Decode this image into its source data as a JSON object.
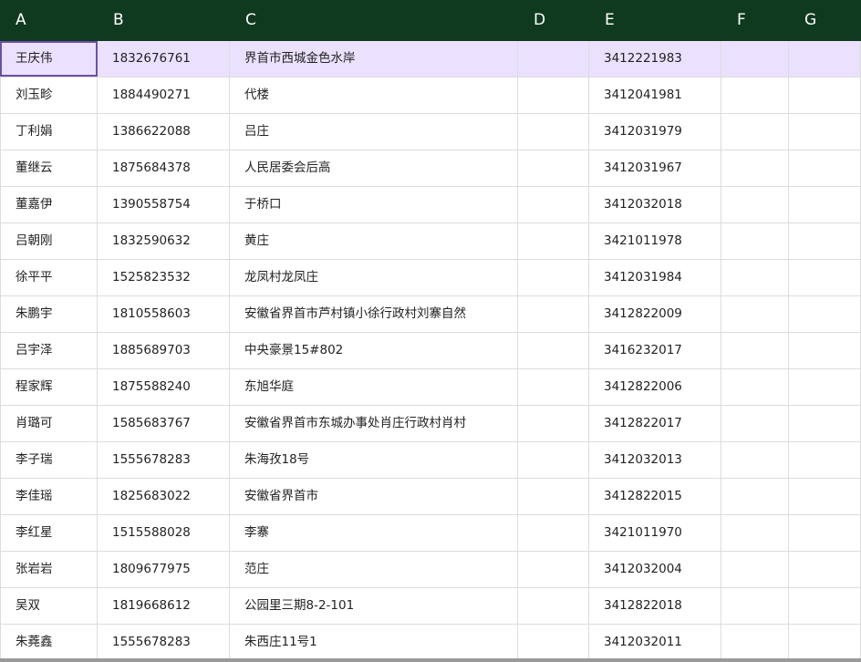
{
  "columns": [
    "A",
    "B",
    "C",
    "D",
    "E",
    "F",
    "G"
  ],
  "rows": [
    [
      "王庆伟",
      "1832676761",
      "界首市西城金色水岸",
      "",
      "3412221983",
      "",
      ""
    ],
    [
      "刘玉畛",
      "1884490271",
      "代楼",
      "",
      "3412041981",
      "",
      ""
    ],
    [
      "丁利娟",
      "1386622088",
      "吕庄",
      "",
      "3412031979",
      "",
      ""
    ],
    [
      "董继云",
      "1875684378",
      "人民居委会后高",
      "",
      "3412031967",
      "",
      ""
    ],
    [
      "董嘉伊",
      "1390558754",
      "于桥口",
      "",
      "3412032018",
      "",
      ""
    ],
    [
      "吕朝刚",
      "1832590632",
      "黄庄",
      "",
      "3421011978",
      "",
      ""
    ],
    [
      "徐平平",
      "1525823532",
      "龙凤村龙凤庄",
      "",
      "3412031984",
      "",
      ""
    ],
    [
      "朱鹏宇",
      "1810558603",
      "安徽省界首市芦村镇小徐行政村刘寨自然",
      "",
      "3412822009",
      "",
      ""
    ],
    [
      "吕宇泽",
      "1885689703",
      "中央豪景15#802",
      "",
      "3416232017",
      "",
      ""
    ],
    [
      "程家辉",
      "1875588240",
      "东旭华庭",
      "",
      "3412822006",
      "",
      ""
    ],
    [
      "肖璐可",
      "1585683767",
      "安徽省界首市东城办事处肖庄行政村肖村",
      "",
      "3412822017",
      "",
      ""
    ],
    [
      "李子瑞",
      "1555678283",
      "朱海孜18号",
      "",
      "3412032013",
      "",
      ""
    ],
    [
      "李佳瑶",
      "1825683022",
      "安徽省界首市",
      "",
      "3412822015",
      "",
      ""
    ],
    [
      "李红星",
      "1515588028",
      "李寨",
      "",
      "3421011970",
      "",
      ""
    ],
    [
      "张岩岩",
      "1809677975",
      "范庄",
      "",
      "3412032004",
      "",
      ""
    ],
    [
      "吴双",
      "1819668612",
      "公园里三期8-2-101",
      "",
      "3412822018",
      "",
      ""
    ],
    [
      "朱蕘鑫",
      "1555678283",
      "朱西庄11号1",
      "",
      "3412032011",
      "",
      ""
    ]
  ],
  "selected_row": 0,
  "colors": {
    "header_bg": "#0f3a1f",
    "header_text": "#ffffff",
    "selected_row_bg": "#ebe1ff",
    "active_cell_border": "#6a4fa8",
    "grid_line": "#dcdcdc"
  }
}
